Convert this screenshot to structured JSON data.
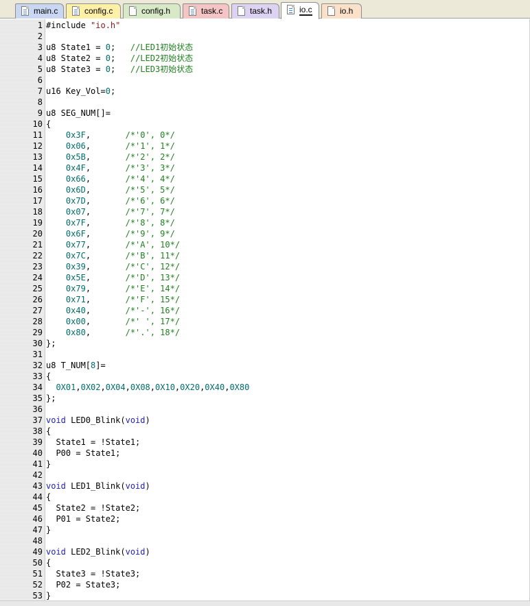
{
  "tabs": [
    {
      "label": "main.c",
      "color": "#c9d7f2",
      "active": false
    },
    {
      "label": "config.c",
      "color": "#fff0a8",
      "active": false
    },
    {
      "label": "config.h",
      "color": "#d7e9c6",
      "active": false
    },
    {
      "label": "task.c",
      "color": "#f5c4c4",
      "active": false
    },
    {
      "label": "task.h",
      "color": "#dcd2f2",
      "active": false
    },
    {
      "label": "io.c",
      "color": "#ffffff",
      "active": true
    },
    {
      "label": "io.h",
      "color": "#fbe1c9",
      "active": false
    }
  ],
  "colors": {
    "keyword": "#1e1ebf",
    "comment": "#208020",
    "number": "#006c6c",
    "string": "#8c1a1a",
    "text": "#000000"
  },
  "code_lines": [
    {
      "n": "1",
      "code": "#include \"io.h\""
    },
    {
      "n": "2",
      "code": ""
    },
    {
      "n": "3",
      "code": "u8 State1 = 0;   //LED1初始状态"
    },
    {
      "n": "4",
      "code": "u8 State2 = 0;   //LED2初始状态"
    },
    {
      "n": "5",
      "code": "u8 State3 = 0;   //LED3初始状态"
    },
    {
      "n": "6",
      "code": ""
    },
    {
      "n": "7",
      "code": "u16 Key_Vol=0;"
    },
    {
      "n": "8",
      "code": ""
    },
    {
      "n": "9",
      "code": "u8 SEG_NUM[]="
    },
    {
      "n": "10",
      "code": "{"
    },
    {
      "n": "11",
      "code": "    0x3F,       /*'0', 0*/"
    },
    {
      "n": "12",
      "code": "    0x06,       /*'1', 1*/"
    },
    {
      "n": "13",
      "code": "    0x5B,       /*'2', 2*/"
    },
    {
      "n": "14",
      "code": "    0x4F,       /*'3', 3*/"
    },
    {
      "n": "15",
      "code": "    0x66,       /*'4', 4*/"
    },
    {
      "n": "16",
      "code": "    0x6D,       /*'5', 5*/"
    },
    {
      "n": "17",
      "code": "    0x7D,       /*'6', 6*/"
    },
    {
      "n": "18",
      "code": "    0x07,       /*'7', 7*/"
    },
    {
      "n": "19",
      "code": "    0x7F,       /*'8', 8*/"
    },
    {
      "n": "20",
      "code": "    0x6F,       /*'9', 9*/"
    },
    {
      "n": "21",
      "code": "    0x77,       /*'A', 10*/"
    },
    {
      "n": "22",
      "code": "    0x7C,       /*'B', 11*/"
    },
    {
      "n": "23",
      "code": "    0x39,       /*'C', 12*/"
    },
    {
      "n": "24",
      "code": "    0x5E,       /*'D', 13*/"
    },
    {
      "n": "25",
      "code": "    0x79,       /*'E', 14*/"
    },
    {
      "n": "26",
      "code": "    0x71,       /*'F', 15*/"
    },
    {
      "n": "27",
      "code": "    0x40,       /*'-', 16*/"
    },
    {
      "n": "28",
      "code": "    0x00,       /*' ', 17*/"
    },
    {
      "n": "29",
      "code": "    0x80,       /*'.', 18*/"
    },
    {
      "n": "30",
      "code": "};"
    },
    {
      "n": "31",
      "code": ""
    },
    {
      "n": "32",
      "code": "u8 T_NUM[8]="
    },
    {
      "n": "33",
      "code": "{"
    },
    {
      "n": "34",
      "code": "  0X01,0X02,0X04,0X08,0X10,0X20,0X40,0X80"
    },
    {
      "n": "35",
      "code": "};"
    },
    {
      "n": "36",
      "code": ""
    },
    {
      "n": "37",
      "code": "void LED0_Blink(void)"
    },
    {
      "n": "38",
      "code": "{"
    },
    {
      "n": "39",
      "code": "  State1 = !State1;"
    },
    {
      "n": "40",
      "code": "  P00 = State1;"
    },
    {
      "n": "41",
      "code": "}"
    },
    {
      "n": "42",
      "code": ""
    },
    {
      "n": "43",
      "code": "void LED1_Blink(void)"
    },
    {
      "n": "44",
      "code": "{"
    },
    {
      "n": "45",
      "code": "  State2 = !State2;"
    },
    {
      "n": "46",
      "code": "  P01 = State2;"
    },
    {
      "n": "47",
      "code": "}"
    },
    {
      "n": "48",
      "code": ""
    },
    {
      "n": "49",
      "code": "void LED2_Blink(void)"
    },
    {
      "n": "50",
      "code": "{"
    },
    {
      "n": "51",
      "code": "  State3 = !State3;"
    },
    {
      "n": "52",
      "code": "  P02 = State3;"
    },
    {
      "n": "53",
      "code": "}"
    }
  ]
}
